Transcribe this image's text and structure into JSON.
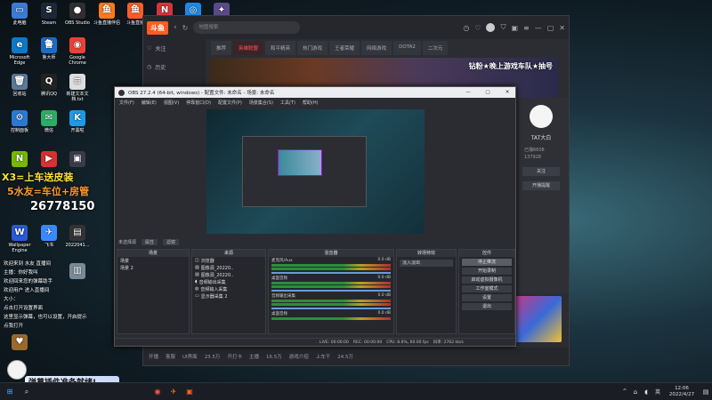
{
  "desktop": {
    "icons": [
      {
        "label": "此电脑",
        "color": "#3a7bd5",
        "glyph": "▭"
      },
      {
        "label": "Steam",
        "color": "#1b2838",
        "glyph": "S"
      },
      {
        "label": "OBS Studio",
        "color": "#302e31",
        "glyph": "●"
      },
      {
        "label": "斗鱼直播伴侣",
        "color": "#ff7a1a",
        "glyph": "鱼"
      },
      {
        "label": "斗鱼直播",
        "color": "#ff5d23",
        "glyph": "鱼"
      },
      {
        "label": "",
        "color": "#d9323a",
        "glyph": "N"
      },
      {
        "label": "",
        "color": "#1e88e5",
        "glyph": "◎"
      },
      {
        "label": "",
        "color": "#5a4a8a",
        "glyph": "✦"
      },
      {
        "label": "Microsoft Edge",
        "color": "#0c7ac8",
        "glyph": "e"
      },
      {
        "label": "鲁大师",
        "color": "#1a6ec8",
        "glyph": "鲁"
      },
      {
        "label": "Google Chrome",
        "color": "#e94235",
        "glyph": "◉"
      },
      {
        "label": "回收站",
        "color": "#5a7a9a",
        "glyph": "🗑"
      },
      {
        "label": "腾讯QQ",
        "color": "#222",
        "glyph": "Q"
      },
      {
        "label": "新建文本文档.txt",
        "color": "#ddd",
        "glyph": "≡"
      },
      {
        "label": "控制面板",
        "color": "#2a7ad5",
        "glyph": "⚙"
      },
      {
        "label": "微信",
        "color": "#2aae67",
        "glyph": "✉"
      },
      {
        "label": "开黑啦",
        "color": "#1e9be8",
        "glyph": "K"
      },
      {
        "label": "",
        "color": "#76b900",
        "glyph": "N"
      },
      {
        "label": "",
        "color": "#d93030",
        "glyph": "▶"
      },
      {
        "label": "",
        "color": "#3a3a4a",
        "glyph": "▣"
      },
      {
        "label": "Wallpaper Engine",
        "color": "#2a5ad5",
        "glyph": "W"
      },
      {
        "label": "飞书",
        "color": "#3a8aff",
        "glyph": "✈"
      },
      {
        "label": "2022041...",
        "color": "#333",
        "glyph": "▤"
      },
      {
        "label": "",
        "color": "#9a6a2a",
        "glyph": "♥"
      },
      {
        "label": "",
        "color": "#7a8a9a",
        "glyph": "▥"
      }
    ]
  },
  "overlay": {
    "line1": "X3=上车送皮装",
    "line2": "5水友=车位+房管",
    "line3": "26778150",
    "bottom_banner": "弹幕插件准备就绪!",
    "chat_lines": [
      "欢迎来到 水友 直播间",
      "主播：你好我叫",
      "欢迎回来您的弹幕助手",
      "欢迎用户 进入直播间",
      "大小：",
      "点击打开设置界面",
      "这里显示弹幕，也可以设置，开启提示",
      "点我打开"
    ]
  },
  "browser": {
    "logo": "斗鱼",
    "search_placeholder": "地图搜索",
    "side": [
      "关注",
      "历史"
    ],
    "tabs": [
      "推荐",
      "英雄联盟",
      "和平精英",
      "热门游戏",
      "王者荣耀",
      "网络游戏",
      "DOTA2",
      "二次元"
    ],
    "banner_text": "钻粉★晚上游戏车队★抽号",
    "right": {
      "name": "TAT大白",
      "fans": "已播6608",
      "id": "137928",
      "btn1": "关注",
      "btn2": "开播提醒"
    },
    "bottom": [
      "开播",
      "客服",
      "UI界面",
      "23.5万",
      "开打卡",
      "主播",
      "16.5万",
      "游戏介绍",
      "上车干",
      "24.5万"
    ]
  },
  "obs": {
    "title": "OBS 27.2.4 (64-bit, windows) - 配置文件: 未命名 - 场景: 未命名",
    "menu": [
      "文件(F)",
      "编辑(E)",
      "视图(V)",
      "停靠窗口(D)",
      "配置文件(P)",
      "场景集合(S)",
      "工具(T)",
      "帮助(H)"
    ],
    "source_label": "未选择源",
    "props_btn": "属性",
    "filter_btn": "滤镜",
    "panels": {
      "scenes": "场景",
      "sources": "来源",
      "mixer": "混音器",
      "transitions": "转场特效",
      "controls": "控件"
    },
    "scenes": [
      "场景",
      "场景 2"
    ],
    "sources": [
      "浏览器",
      "图像源_20220..",
      "图像源_20220..",
      "音频输出采集",
      "音频输入采集",
      "显示器采集 2"
    ],
    "mixer": [
      {
        "name": "麦克风/Aux",
        "db": "0.0 dB"
      },
      {
        "name": "桌面音频",
        "db": "0.0 dB"
      },
      {
        "name": "音频输出采集",
        "db": "0.0 dB"
      },
      {
        "name": "桌面音频",
        "db": "0.0 dB"
      }
    ],
    "transition": "淡入淡出",
    "controls": [
      "停止推流",
      "开始录制",
      "启动虚拟摄像机",
      "工作室模式",
      "设置",
      "退出"
    ],
    "status": [
      "LIVE: 00:00:00",
      "REC: 00:00:00",
      "CPU: 8.6%, 60.00 fps",
      "码率: 2762 kb/s"
    ]
  },
  "taskbar": {
    "time": "12:06",
    "date": "2022/4/27",
    "lang": "英"
  }
}
